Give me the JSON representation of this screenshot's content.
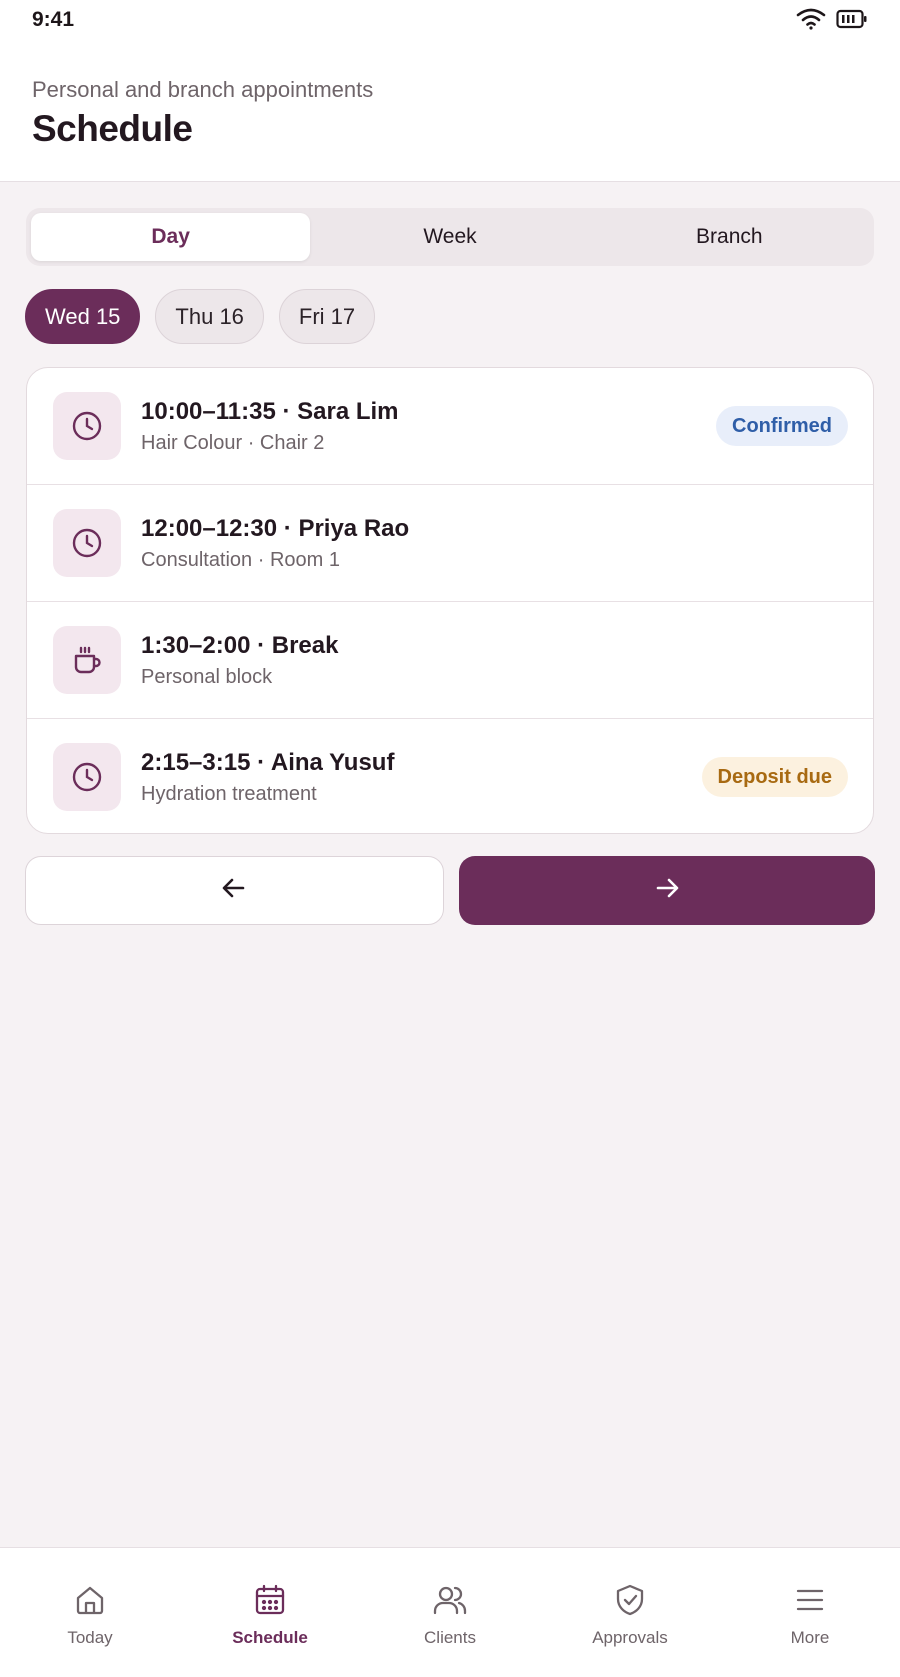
{
  "status_bar": {
    "time": "9:41"
  },
  "header": {
    "subtitle": "Personal and branch appointments",
    "title": "Schedule"
  },
  "view_tabs": [
    {
      "label": "Day",
      "active": true
    },
    {
      "label": "Week",
      "active": false
    },
    {
      "label": "Branch",
      "active": false
    }
  ],
  "date_chips": [
    {
      "label": "Wed 15",
      "active": true
    },
    {
      "label": "Thu 16",
      "active": false
    },
    {
      "label": "Fri 17",
      "active": false
    }
  ],
  "appointments": [
    {
      "icon": "clock-icon",
      "title": "10:00–11:35 · Sara Lim",
      "subtitle": "Hair Colour · Chair 2",
      "badge": "Confirmed"
    },
    {
      "icon": "clock-icon",
      "title": "12:00–12:30 · Priya Rao",
      "subtitle": "Consultation · Room 1",
      "badge": ""
    },
    {
      "icon": "coffee-cup-icon",
      "title": "1:30–2:00 · Break",
      "subtitle": "Personal block",
      "badge": ""
    },
    {
      "icon": "clock-icon",
      "title": "2:15–3:15 · Aina Yusuf",
      "subtitle": "Hydration treatment",
      "badge": "Deposit due"
    }
  ],
  "nav_buttons": {
    "prev_icon": "arrow-left-icon",
    "next_icon": "arrow-right-icon"
  },
  "tabbar": [
    {
      "label": "Today",
      "icon": "home-icon",
      "active": false
    },
    {
      "label": "Schedule",
      "icon": "calendar-icon",
      "active": true
    },
    {
      "label": "Clients",
      "icon": "users-icon",
      "active": false
    },
    {
      "label": "Approvals",
      "icon": "shield-check-icon",
      "active": false
    },
    {
      "label": "More",
      "icon": "menu-icon",
      "active": false
    }
  ],
  "colors": {
    "accent": "#6b2d5a",
    "background": "#f6f2f4",
    "confirmed_text": "#2f5ea8",
    "confirmed_bg": "#e8eefa",
    "deposit_text": "#a86a12",
    "deposit_bg": "#fcf1df"
  }
}
